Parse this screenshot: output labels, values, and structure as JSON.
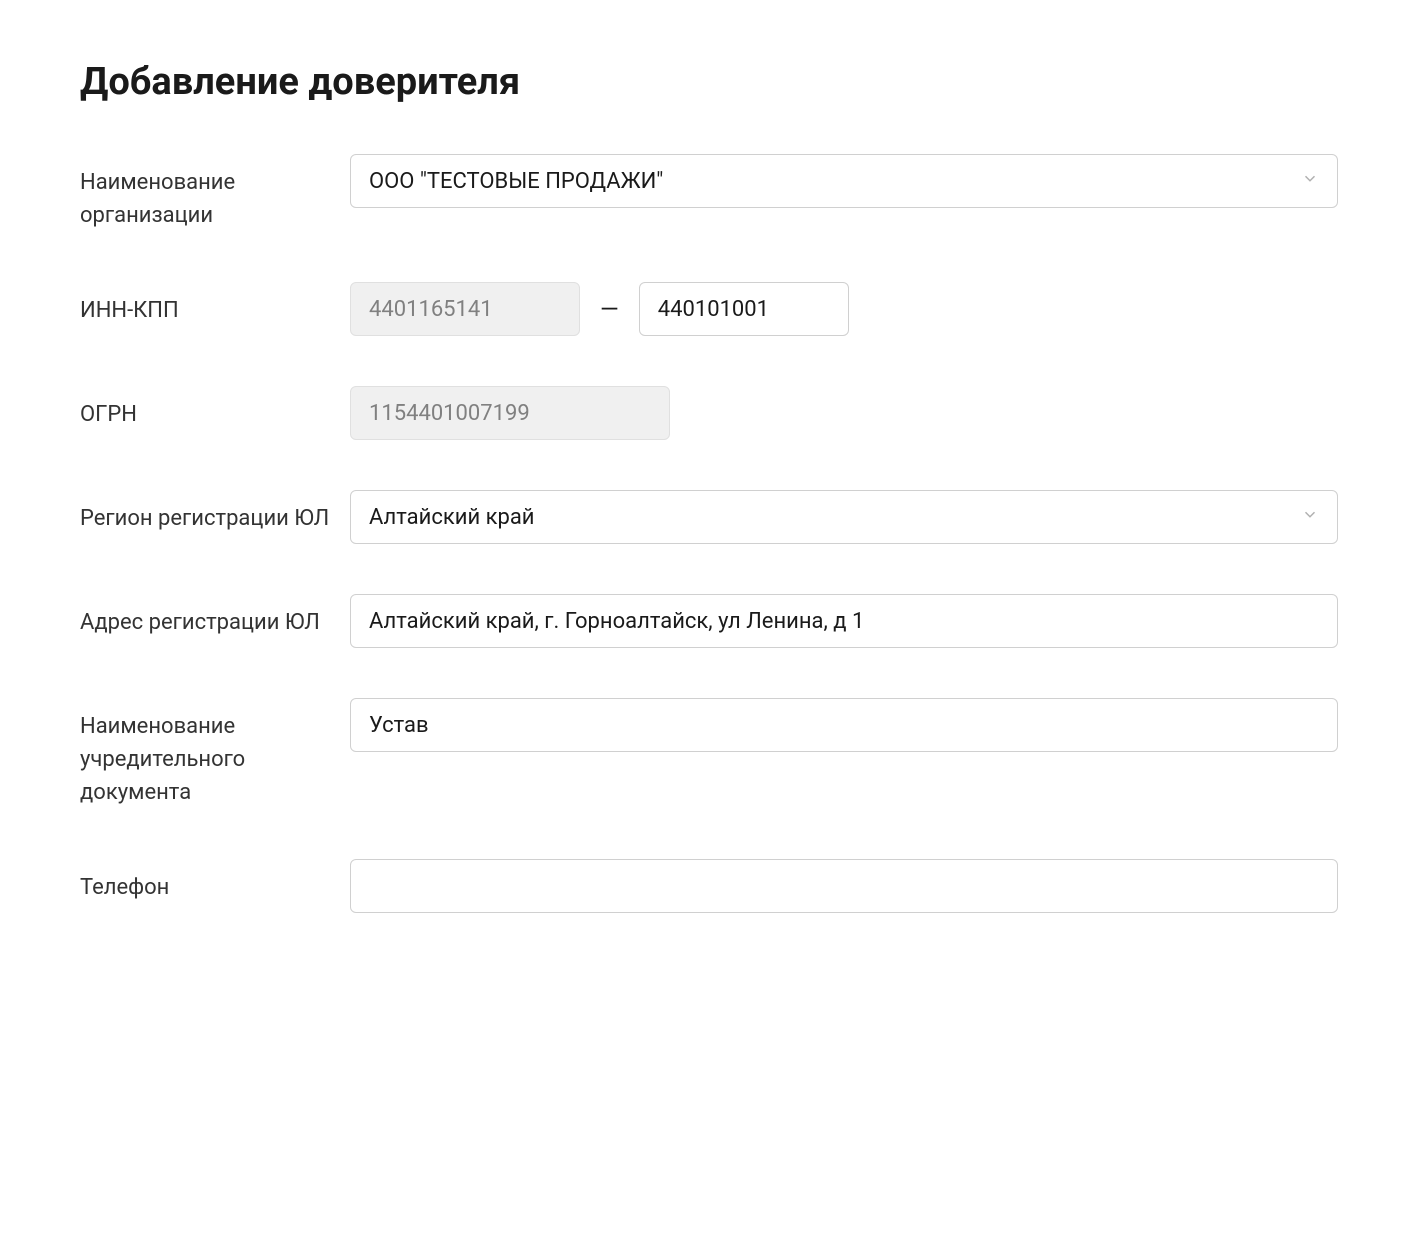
{
  "title": "Добавление доверителя",
  "form": {
    "org_name": {
      "label": "Наименование организации",
      "value": "ООО \"ТЕСТОВЫЕ ПРОДАЖИ\""
    },
    "inn_kpp": {
      "label": "ИНН-КПП",
      "inn": "4401165141",
      "kpp": "440101001",
      "separator": "—"
    },
    "ogrn": {
      "label": "ОГРН",
      "value": "1154401007199"
    },
    "region": {
      "label": "Регион регистрации ЮЛ",
      "value": "Алтайский край"
    },
    "address": {
      "label": "Адрес регистрации ЮЛ",
      "value": "Алтайский край, г. Горноалтайск, ул Ленина, д 1"
    },
    "founding_doc": {
      "label": "Наименование учредительного документа",
      "value": "Устав"
    },
    "phone": {
      "label": "Телефон",
      "value": ""
    }
  }
}
